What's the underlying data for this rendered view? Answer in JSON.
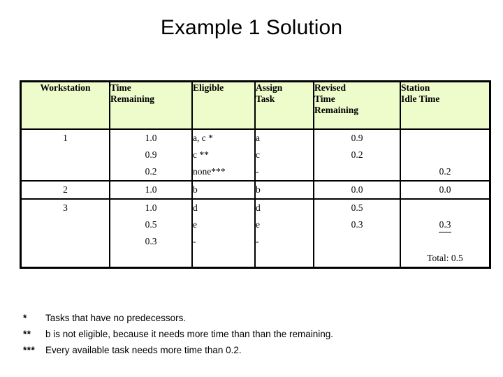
{
  "slide": {
    "title": "Example 1 Solution",
    "header_fill": "#EEFBCB",
    "border_color": "#000000",
    "background": "#FFFFFF"
  },
  "table": {
    "columns": [
      {
        "id": "workstation",
        "label": "Workstation",
        "label_lines": [
          "Workstation"
        ]
      },
      {
        "id": "time_remaining",
        "label": "Time Remaining",
        "label_lines": [
          "Time",
          "Remaining"
        ]
      },
      {
        "id": "eligible",
        "label": "Eligible",
        "label_lines": [
          "Eligible"
        ]
      },
      {
        "id": "assign_task",
        "label": "Assign Task",
        "label_lines": [
          "Assign",
          "Task"
        ]
      },
      {
        "id": "revised_time",
        "label": "Revised Time Remaining",
        "label_lines": [
          "Revised",
          "Time",
          "Remaining"
        ]
      },
      {
        "id": "station_idle",
        "label": "Station Idle Time",
        "label_lines": [
          "Station",
          "Idle Time"
        ]
      }
    ],
    "rows": [
      {
        "workstation": "1",
        "time_remaining": [
          "1.0",
          "0.9",
          "0.2"
        ],
        "eligible": [
          "a, c *",
          "c **",
          "none***"
        ],
        "assign_task": [
          "a",
          "c",
          "-"
        ],
        "revised_time": [
          "0.9",
          "0.2",
          ""
        ],
        "station_idle": [
          "",
          "",
          "0.2"
        ],
        "station_idle_underline": [
          false,
          false,
          false
        ],
        "total": ""
      },
      {
        "workstation": "2",
        "time_remaining": [
          "1.0"
        ],
        "eligible": [
          "b"
        ],
        "assign_task": [
          "b"
        ],
        "revised_time": [
          "0.0"
        ],
        "station_idle": [
          "0.0"
        ],
        "station_idle_underline": [
          false
        ],
        "total": ""
      },
      {
        "workstation": "3",
        "time_remaining": [
          "1.0",
          "0.5",
          "0.3"
        ],
        "eligible": [
          "d",
          "e",
          "-"
        ],
        "assign_task": [
          "d",
          "e",
          "-"
        ],
        "revised_time": [
          "0.5",
          "0.3",
          ""
        ],
        "station_idle": [
          "",
          "0.3",
          ""
        ],
        "station_idle_underline": [
          false,
          true,
          false
        ],
        "total": "Total: 0.5"
      }
    ]
  },
  "footnotes": [
    {
      "mark": "*",
      "text": "Tasks that have no predecessors."
    },
    {
      "mark": "**",
      "text": "b is not eligible, because it needs more time than than the remaining."
    },
    {
      "mark": "***",
      "text": "Every available task needs more time than 0.2."
    }
  ]
}
